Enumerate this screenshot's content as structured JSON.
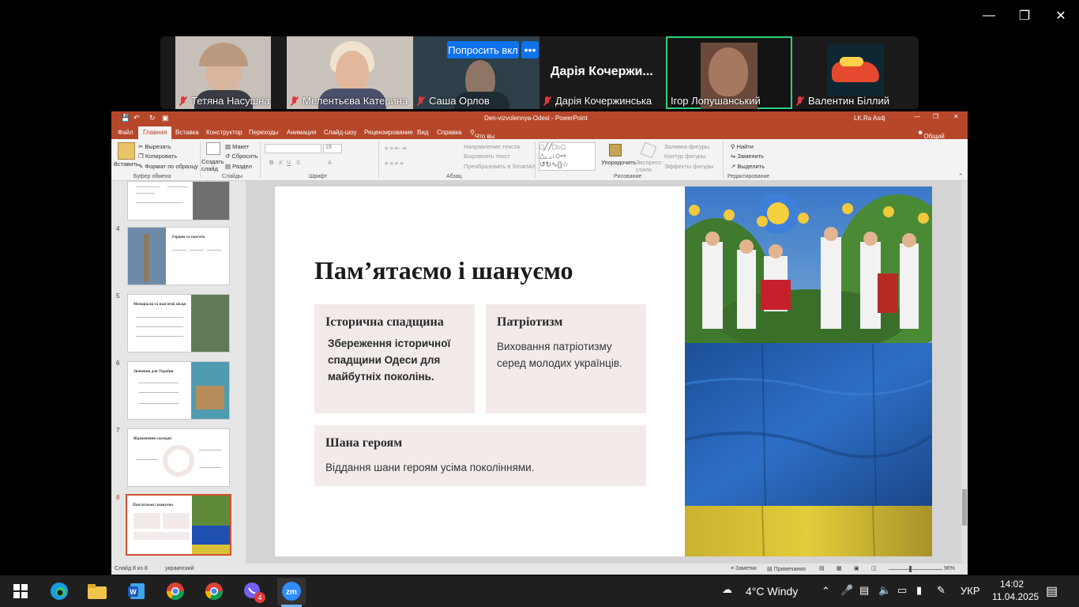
{
  "zoom": {
    "ask_label": "Попросить вкл",
    "more_label": "•••",
    "participants": [
      {
        "name": "Тетяна Насушна",
        "muted": true
      },
      {
        "name": "Мелентьєва Катерина",
        "muted": true
      },
      {
        "name": "Саша Орлов",
        "muted": true
      },
      {
        "name": "Дарія Кочержинська",
        "muted": true,
        "display": "Дарія Кочержи..."
      },
      {
        "name": "Ігор Лопушанський",
        "muted": false,
        "speaking": true
      },
      {
        "name": "Валентин Біллий",
        "muted": true
      }
    ],
    "active_color": "#2ed179"
  },
  "ppt": {
    "title_bar": "Den-vizvolennya-Odesi  -  PowerPoint",
    "user": "LK.Ra Asdj",
    "tabs": [
      "Файл",
      "Главная",
      "Вставка",
      "Конструктор",
      "Переходы",
      "Анимация",
      "Слайд-шоу",
      "Рецензирование",
      "Вид",
      "Справка",
      "Что вы хотите сделать?"
    ],
    "share": "Общий доступ",
    "ribbon": {
      "paste": "Вставить",
      "cut": "Вырезать",
      "copy": "Копировать",
      "format": "Формат по образцу",
      "clipboard": "Буфер обмена",
      "new_slide": "Создать слайд",
      "layout": "Макет",
      "reset": "Сбросить",
      "section": "Раздел",
      "slides": "Слайды",
      "font_size": "19",
      "font": "Шрифт",
      "text_dir": "Направление текста",
      "align_text": "Выровнять текст",
      "smartart": "Преобразовать в SmartArt",
      "paragraph": "Абзац",
      "arrange": "Упорядочить",
      "express": "Экспресс-стили",
      "fill": "Заливка фигуры",
      "outline": "Контур фигуры",
      "effects": "Эффекты фигуры",
      "drawing": "Рисование",
      "find": "Найти",
      "replace": "Заменить",
      "select": "Выделить",
      "editing": "Редактирование"
    },
    "thumbnails": [
      {
        "num": "4",
        "title": "Героям та пам'ять"
      },
      {
        "num": "5",
        "title": "Меморіали та пам'ятні місця"
      },
      {
        "num": "6",
        "title": "Значення для України"
      },
      {
        "num": "7",
        "title": "Відзначення сьогодні"
      },
      {
        "num": "8",
        "title": "Пам'ятаємо і шануємо"
      }
    ],
    "slide": {
      "title": "Пам’ятаємо і шануємо",
      "cards": [
        {
          "heading": "Історична спадщина",
          "text": "Збереження історичної спадщини Одеси для майбутніх поколінь."
        },
        {
          "heading": "Патріотизм",
          "text": "Виховання патріотизму серед молодих українців."
        },
        {
          "heading": "Шана героям",
          "text": "Віддання шани героям усіма поколіннями."
        }
      ]
    },
    "status": {
      "slide_of": "Слайд 8 из 8",
      "language": "украинский",
      "notes": "Заметки",
      "comments": "Примечания",
      "zoom": "96%"
    }
  },
  "taskbar": {
    "weather": "4°C  Windy",
    "language": "УКР",
    "time": "14:02",
    "date": "11.04.2025",
    "viber_badge": "4"
  }
}
